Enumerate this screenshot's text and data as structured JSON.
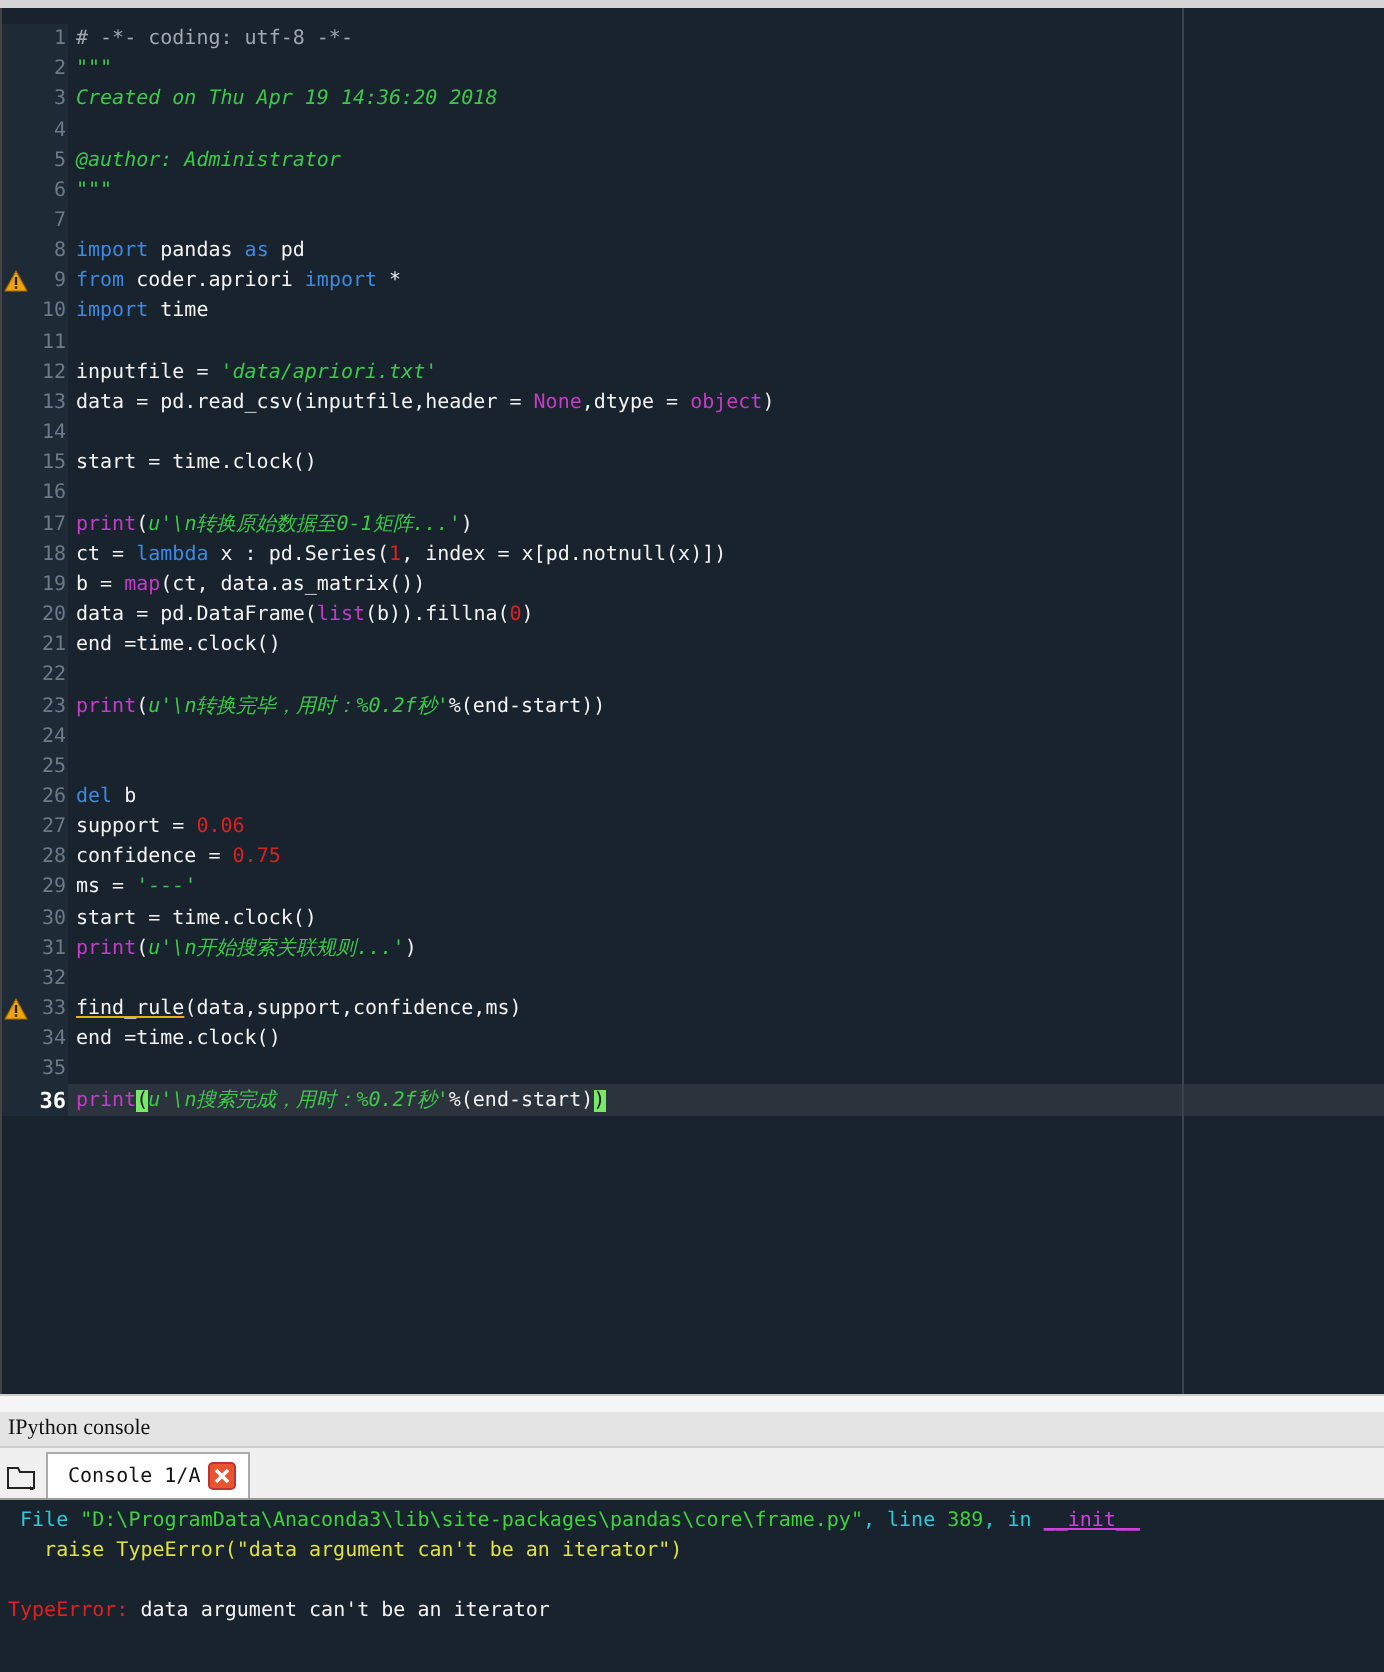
{
  "editor": {
    "lines": [
      {
        "number": "1",
        "current": false,
        "warning": false,
        "tokens": [
          {
            "kind": "comment",
            "text": "# -*- coding: utf-8 -*-"
          }
        ]
      },
      {
        "number": "2",
        "current": false,
        "warning": false,
        "tokens": [
          {
            "kind": "docstring",
            "text": "\"\"\""
          }
        ]
      },
      {
        "number": "3",
        "current": false,
        "warning": false,
        "tokens": [
          {
            "kind": "docstring",
            "text": "Created on Thu Apr 19 14:36:20 2018"
          }
        ]
      },
      {
        "number": "4",
        "current": false,
        "warning": false
      },
      {
        "number": "5",
        "current": false,
        "warning": false,
        "tokens": [
          {
            "kind": "docstring",
            "text": "@author: Administrator"
          }
        ]
      },
      {
        "number": "6",
        "current": false,
        "warning": false,
        "tokens": [
          {
            "kind": "docstring",
            "text": "\"\"\""
          }
        ]
      },
      {
        "number": "7",
        "current": false,
        "warning": false
      },
      {
        "number": "8",
        "current": false,
        "warning": false,
        "tokens": [
          {
            "kind": "keyword",
            "text": "import"
          },
          {
            "kind": "plain",
            "text": " pandas "
          },
          {
            "kind": "keyword",
            "text": "as"
          },
          {
            "kind": "plain",
            "text": " pd"
          }
        ]
      },
      {
        "number": "9",
        "current": false,
        "warning": true,
        "tokens": [
          {
            "kind": "keyword",
            "text": "from"
          },
          {
            "kind": "plain",
            "text": " coder.apriori "
          },
          {
            "kind": "keyword",
            "text": "import"
          },
          {
            "kind": "plain",
            "text": " *"
          }
        ]
      },
      {
        "number": "10",
        "current": false,
        "warning": false,
        "tokens": [
          {
            "kind": "keyword",
            "text": "import"
          },
          {
            "kind": "plain",
            "text": " time"
          }
        ]
      },
      {
        "number": "11",
        "current": false,
        "warning": false
      },
      {
        "number": "12",
        "current": false,
        "warning": false,
        "tokens": [
          {
            "kind": "plain",
            "text": "inputfile = "
          },
          {
            "kind": "string",
            "text": "'data/apriori.txt'"
          }
        ]
      },
      {
        "number": "13",
        "current": false,
        "warning": false,
        "tokens": [
          {
            "kind": "plain",
            "text": "data = pd.read_csv(inputfile,header = "
          },
          {
            "kind": "builtin",
            "text": "None"
          },
          {
            "kind": "plain",
            "text": ",dtype = "
          },
          {
            "kind": "builtin",
            "text": "object"
          },
          {
            "kind": "plain",
            "text": ")"
          }
        ]
      },
      {
        "number": "14",
        "current": false,
        "warning": false
      },
      {
        "number": "15",
        "current": false,
        "warning": false,
        "tokens": [
          {
            "kind": "plain",
            "text": "start = time.clock()"
          }
        ]
      },
      {
        "number": "16",
        "current": false,
        "warning": false
      },
      {
        "number": "17",
        "current": false,
        "warning": false,
        "tokens": [
          {
            "kind": "builtin",
            "text": "print"
          },
          {
            "kind": "plain",
            "text": "("
          },
          {
            "kind": "string",
            "text": "u'\\n转换原始数据至0-1矩阵...'"
          },
          {
            "kind": "plain",
            "text": ")"
          }
        ]
      },
      {
        "number": "18",
        "current": false,
        "warning": false,
        "tokens": [
          {
            "kind": "plain",
            "text": "ct = "
          },
          {
            "kind": "keyword",
            "text": "lambda"
          },
          {
            "kind": "plain",
            "text": " x : pd.Series("
          },
          {
            "kind": "number",
            "text": "1"
          },
          {
            "kind": "plain",
            "text": ", index = x[pd.notnull(x)])"
          }
        ]
      },
      {
        "number": "19",
        "current": false,
        "warning": false,
        "tokens": [
          {
            "kind": "plain",
            "text": "b = "
          },
          {
            "kind": "builtin",
            "text": "map"
          },
          {
            "kind": "plain",
            "text": "(ct, data.as_matrix())"
          }
        ]
      },
      {
        "number": "20",
        "current": false,
        "warning": false,
        "tokens": [
          {
            "kind": "plain",
            "text": "data = pd.DataFrame("
          },
          {
            "kind": "builtin",
            "text": "list"
          },
          {
            "kind": "plain",
            "text": "(b)).fillna("
          },
          {
            "kind": "number",
            "text": "0"
          },
          {
            "kind": "plain",
            "text": ")"
          }
        ]
      },
      {
        "number": "21",
        "current": false,
        "warning": false,
        "tokens": [
          {
            "kind": "plain",
            "text": "end =time.clock()"
          }
        ]
      },
      {
        "number": "22",
        "current": false,
        "warning": false
      },
      {
        "number": "23",
        "current": false,
        "warning": false,
        "tokens": [
          {
            "kind": "builtin",
            "text": "print"
          },
          {
            "kind": "plain",
            "text": "("
          },
          {
            "kind": "string",
            "text": "u'\\n转换完毕，用时：%0.2f秒'"
          },
          {
            "kind": "plain",
            "text": "%(end-start))"
          }
        ]
      },
      {
        "number": "24",
        "current": false,
        "warning": false
      },
      {
        "number": "25",
        "current": false,
        "warning": false
      },
      {
        "number": "26",
        "current": false,
        "warning": false,
        "tokens": [
          {
            "kind": "keyword",
            "text": "del"
          },
          {
            "kind": "plain",
            "text": " b"
          }
        ]
      },
      {
        "number": "27",
        "current": false,
        "warning": false,
        "tokens": [
          {
            "kind": "plain",
            "text": "support = "
          },
          {
            "kind": "number",
            "text": "0.06"
          }
        ]
      },
      {
        "number": "28",
        "current": false,
        "warning": false,
        "tokens": [
          {
            "kind": "plain",
            "text": "confidence = "
          },
          {
            "kind": "number",
            "text": "0.75"
          }
        ]
      },
      {
        "number": "29",
        "current": false,
        "warning": false,
        "tokens": [
          {
            "kind": "plain",
            "text": "ms = "
          },
          {
            "kind": "string",
            "text": "'---'"
          }
        ]
      },
      {
        "number": "30",
        "current": false,
        "warning": false,
        "tokens": [
          {
            "kind": "plain",
            "text": "start = time.clock()"
          }
        ]
      },
      {
        "number": "31",
        "current": false,
        "warning": false,
        "tokens": [
          {
            "kind": "builtin",
            "text": "print"
          },
          {
            "kind": "plain",
            "text": "("
          },
          {
            "kind": "string",
            "text": "u'\\n开始搜索关联规则...'"
          },
          {
            "kind": "plain",
            "text": ")"
          }
        ]
      },
      {
        "number": "32",
        "current": false,
        "warning": false
      },
      {
        "number": "33",
        "current": false,
        "warning": true,
        "tokens": [
          {
            "kind": "flagged",
            "text": "find_rule"
          },
          {
            "kind": "plain",
            "text": "(data,support,confidence,ms)"
          }
        ]
      },
      {
        "number": "34",
        "current": false,
        "warning": false,
        "tokens": [
          {
            "kind": "plain",
            "text": "end =time.clock()"
          }
        ]
      },
      {
        "number": "35",
        "current": false,
        "warning": false
      },
      {
        "number": "36",
        "current": true,
        "warning": false,
        "tokens": [
          {
            "kind": "builtin",
            "text": "print"
          },
          {
            "kind": "bracket",
            "text": "("
          },
          {
            "kind": "string",
            "text": "u'\\n搜索完成，用时：%0.2f秒'"
          },
          {
            "kind": "plain",
            "text": "%(end-start)"
          },
          {
            "kind": "bracket",
            "text": ")"
          }
        ]
      }
    ]
  },
  "console_pane": {
    "title": "IPython console",
    "tabs": [
      {
        "label": "Console 1/A",
        "selected": true
      }
    ],
    "traceback": [
      {
        "tokens": [
          {
            "kind": "info",
            "text": " File "
          },
          {
            "kind": "path",
            "text": "\"D:\\ProgramData\\Anaconda3\\lib\\site-packages\\pandas\\core\\frame.py\""
          },
          {
            "kind": "info",
            "text": ", line "
          },
          {
            "kind": "path",
            "text": "389"
          },
          {
            "kind": "info",
            "text": ", in "
          },
          {
            "kind": "func",
            "text": "__init__"
          }
        ]
      },
      {
        "tokens": [
          {
            "kind": "source",
            "text": "   raise TypeError(\"data argument can't be an iterator\")"
          }
        ]
      }
    ],
    "error": {
      "tokens": [
        {
          "kind": "error",
          "text": "TypeError:"
        },
        {
          "kind": "plain",
          "text": " data argument can't be an iterator"
        }
      ]
    }
  }
}
